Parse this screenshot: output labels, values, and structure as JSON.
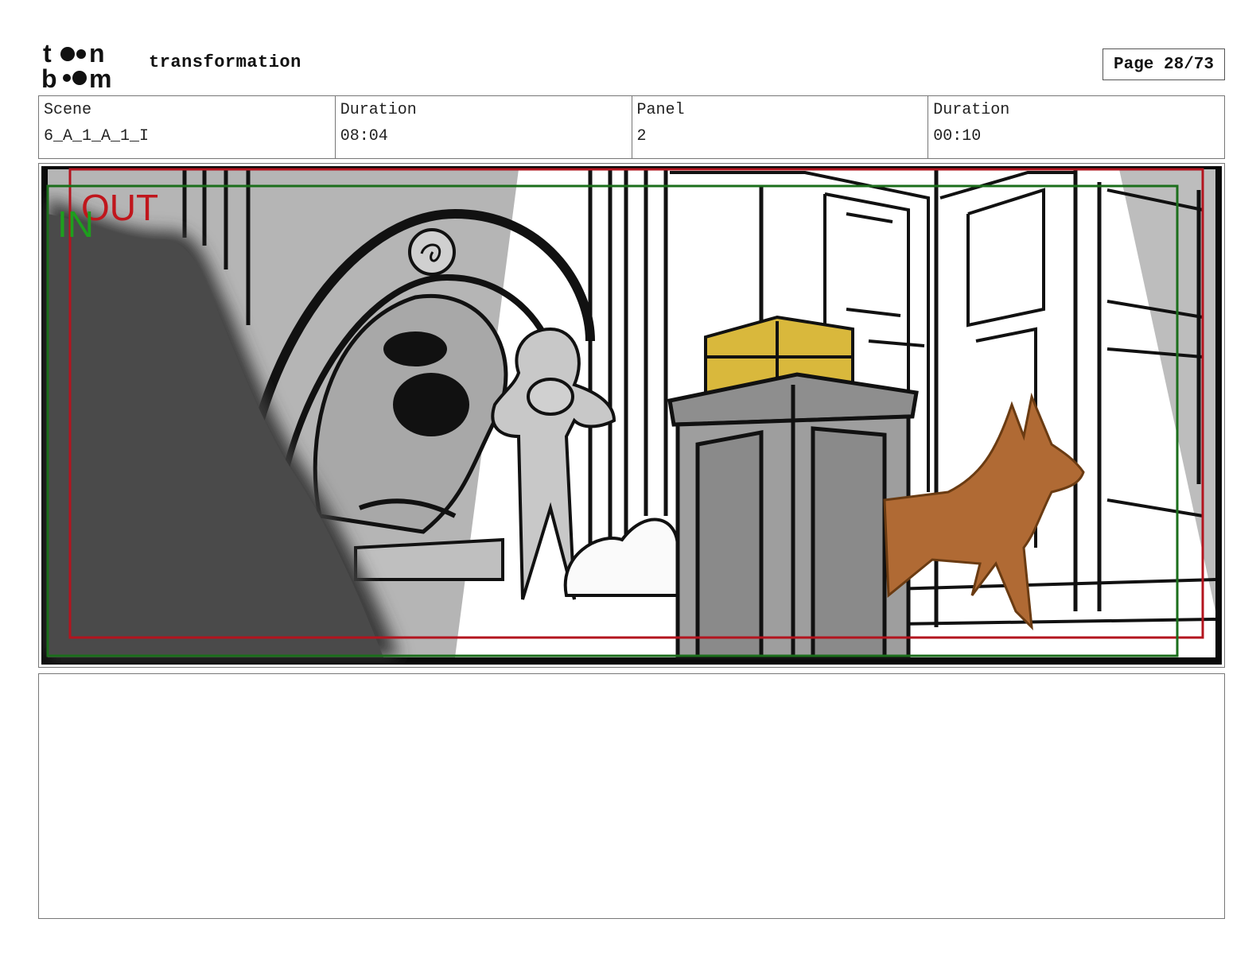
{
  "header": {
    "title": "transformation",
    "page_label": "Page 28/73"
  },
  "info": {
    "scene_label": "Scene",
    "scene_value": "6_A_1_A_1_I",
    "duration1_label": "Duration",
    "duration1_value": "08:04",
    "panel_label": "Panel",
    "panel_value": "2",
    "duration2_label": "Duration",
    "duration2_value": "00:10"
  },
  "panel": {
    "in_label": "IN",
    "out_label": "OUT",
    "in_color": "#1e9e1e",
    "out_color": "#c0161c",
    "in_frame_color": "#1b6e1b",
    "out_frame_color": "#b3141e",
    "dog_color": "#b06a34",
    "chest_color": "#d9b83c"
  },
  "notes": {
    "text": ""
  }
}
